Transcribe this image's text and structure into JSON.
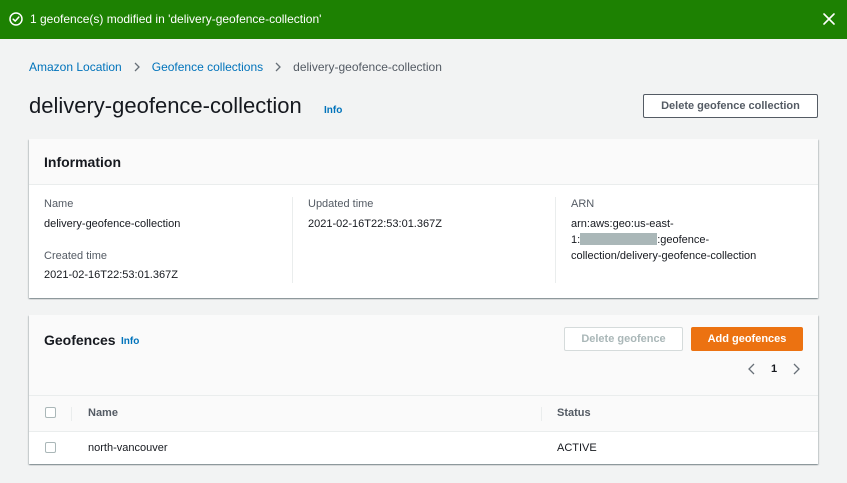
{
  "flash": {
    "message": "1 geofence(s) modified in 'delivery-geofence-collection'",
    "icon": "check-circle-icon",
    "close_icon": "close-icon",
    "color": "#1d8102"
  },
  "breadcrumb": {
    "items": [
      "Amazon Location",
      "Geofence collections"
    ],
    "current": "delivery-geofence-collection"
  },
  "header": {
    "title": "delivery-geofence-collection",
    "info": "Info",
    "delete_button": "Delete geofence collection"
  },
  "information": {
    "title": "Information",
    "name_label": "Name",
    "name_value": "delivery-geofence-collection",
    "created_label": "Created time",
    "created_value": "2021-02-16T22:53:01.367Z",
    "updated_label": "Updated time",
    "updated_value": "2021-02-16T22:53:01.367Z",
    "arn_label": "ARN",
    "arn_line1": "arn:aws:geo:us-east-",
    "arn_line2_prefix": "1:",
    "arn_line2_suffix": ":geofence-",
    "arn_line3": "collection/delivery-geofence-collection"
  },
  "geofences": {
    "title": "Geofences",
    "info": "Info",
    "delete_button": "Delete geofence",
    "add_button": "Add geofences",
    "page": "1",
    "columns": [
      "Name",
      "Status"
    ],
    "rows": [
      {
        "name": "north-vancouver",
        "status": "ACTIVE"
      }
    ]
  },
  "colors": {
    "link": "#0073bb",
    "primary": "#ec7211",
    "success": "#1d8102"
  }
}
